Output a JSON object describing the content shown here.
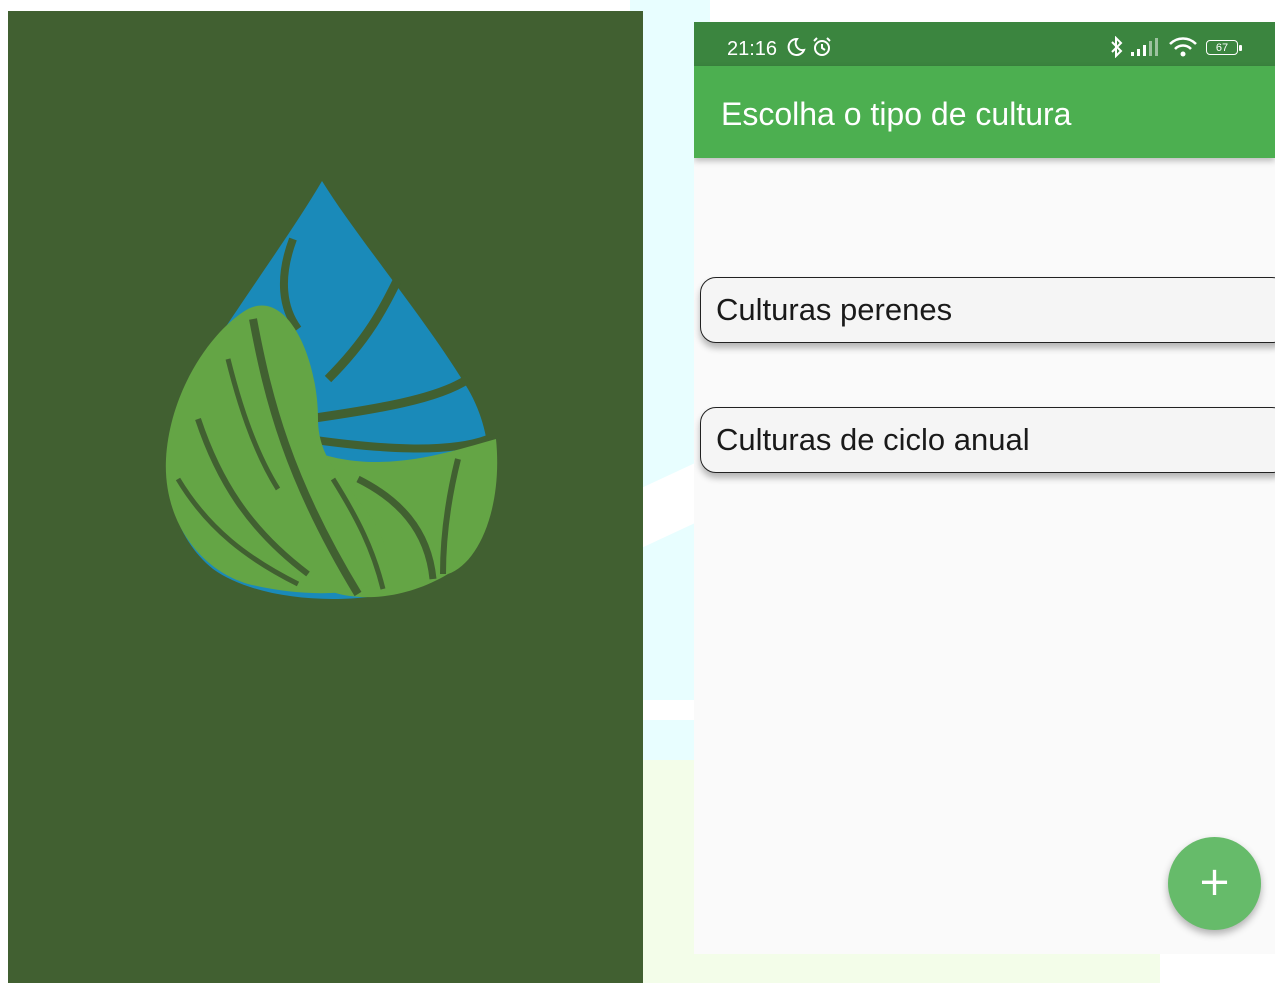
{
  "status_bar": {
    "time": "21:16",
    "battery": "67",
    "icons": [
      "moon-icon",
      "alarm-icon",
      "bluetooth-icon",
      "signal-icon",
      "wifi-icon",
      "battery-icon"
    ]
  },
  "app_bar": {
    "title": "Escolha o tipo de cultura"
  },
  "options": [
    {
      "label": "Culturas perenes"
    },
    {
      "label": "Culturas de ciclo anual"
    }
  ],
  "fab": {
    "icon": "plus-icon",
    "symbol": "+"
  },
  "colors": {
    "splash_background": "#416031",
    "logo_water": "#1a8ab9",
    "logo_leaf": "#64a545",
    "status_bar": "#3b853f",
    "app_bar": "#4caf50",
    "fab": "#66bb6a",
    "screen_background": "#fafafa"
  }
}
